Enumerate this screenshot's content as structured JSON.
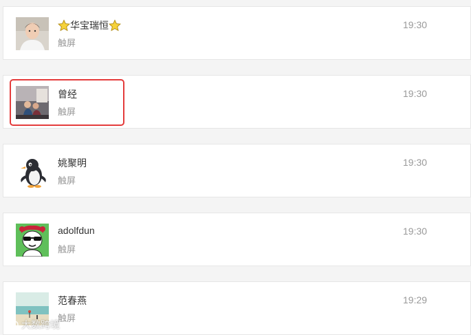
{
  "contacts": [
    {
      "name": "华宝瑞恒",
      "subtitle": "触屏",
      "time": "19:30",
      "avatar": "man-portrait-avatar",
      "name_decorations": [
        "star-icon",
        "star-icon"
      ]
    },
    {
      "name": "曾经",
      "subtitle": "触屏",
      "time": "19:30",
      "avatar": "group-photo-avatar",
      "highlighted": true
    },
    {
      "name": "姚聚明",
      "subtitle": "触屏",
      "time": "19:30",
      "avatar": "penguin-avatar"
    },
    {
      "name": "adolfdun",
      "subtitle": "触屏",
      "time": "19:30",
      "avatar": "panda-cartoon-avatar"
    },
    {
      "name": "范春燕",
      "subtitle": "触屏",
      "time": "19:29",
      "avatar": "beach-scene-avatar"
    }
  ],
  "highlight_color": "#e43b3b",
  "watermark": {
    "text": "大数跨境"
  }
}
